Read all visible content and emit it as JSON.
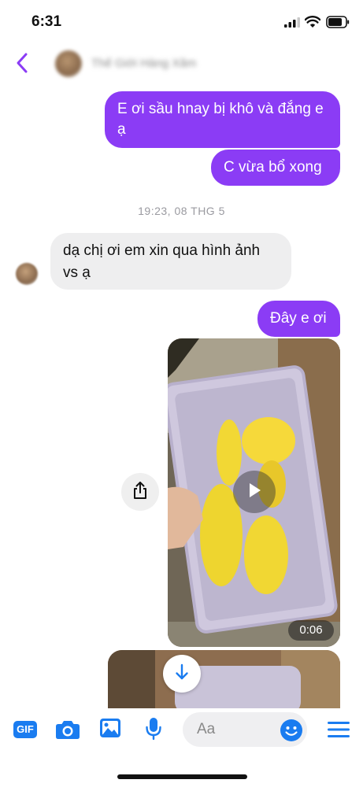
{
  "status_bar": {
    "time": "6:31"
  },
  "header": {
    "contact_name": "Thế Giới Hàng Xăm"
  },
  "messages": [
    {
      "dir": "out",
      "text": "E ơi sầu hnay bị khô và đắng e ạ"
    },
    {
      "dir": "out",
      "text": "C vừa bổ xong"
    },
    {
      "dir": "in",
      "text": "dạ chị ơi em xin qua hình ảnh vs ạ"
    },
    {
      "dir": "out",
      "text": "Đây e ơi"
    }
  ],
  "timestamp": "19:23, 08 THG 5",
  "video": {
    "duration": "0:06"
  },
  "composer": {
    "gif_label": "GIF",
    "placeholder": "Aa",
    "icons": [
      "gif-icon",
      "camera-icon",
      "image-icon",
      "microphone-icon",
      "emoji-icon",
      "menu-icon"
    ]
  },
  "colors": {
    "accent": "#8b3cf5",
    "incoming_bubble": "#eeeeef",
    "icon_blue": "#1a7cf0"
  }
}
